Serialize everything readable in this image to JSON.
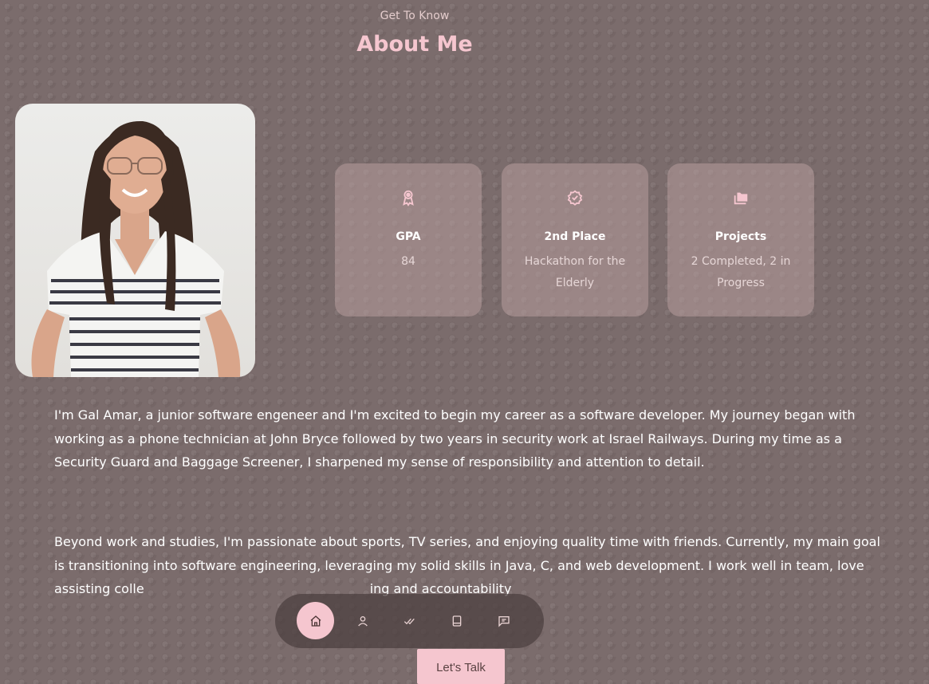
{
  "header": {
    "subtitle": "Get To Know",
    "title": "About Me"
  },
  "cards": [
    {
      "icon": "award-icon",
      "title": "GPA",
      "value": "84"
    },
    {
      "icon": "verified-badge-icon",
      "title": "2nd Place",
      "value": "Hackathon for the Elderly"
    },
    {
      "icon": "folders-icon",
      "title": "Projects",
      "value": "2 Completed, 2 in Progress"
    }
  ],
  "about": {
    "paragraph1": "I'm Gal Amar, a junior software engeneer and I'm excited to begin my career as a software developer. My journey began with working as a phone technician at John Bryce followed by two years in security work at Israel Railways. During my time as a Security Guard and Baggage Screener, I sharpened my sense of responsibility and attention to detail.",
    "paragraph2": "Beyond work and studies, I'm passionate about sports, TV series, and enjoying quality time with friends. Currently, my main goal is transitioning into software engineering, leveraging my solid skills in Java, C, and web development. I work well in team, love assisting colle"
  },
  "nav": {
    "items": [
      "home-icon",
      "user-icon",
      "double-check-icon",
      "book-icon",
      "message-icon"
    ],
    "active": "home-icon",
    "peek_text": "ing and accountability"
  },
  "cta": {
    "label": "Let's Talk"
  },
  "colors": {
    "accent": "#f5c6cf",
    "background": "#7b6c6c",
    "card": "#a28b8b"
  }
}
